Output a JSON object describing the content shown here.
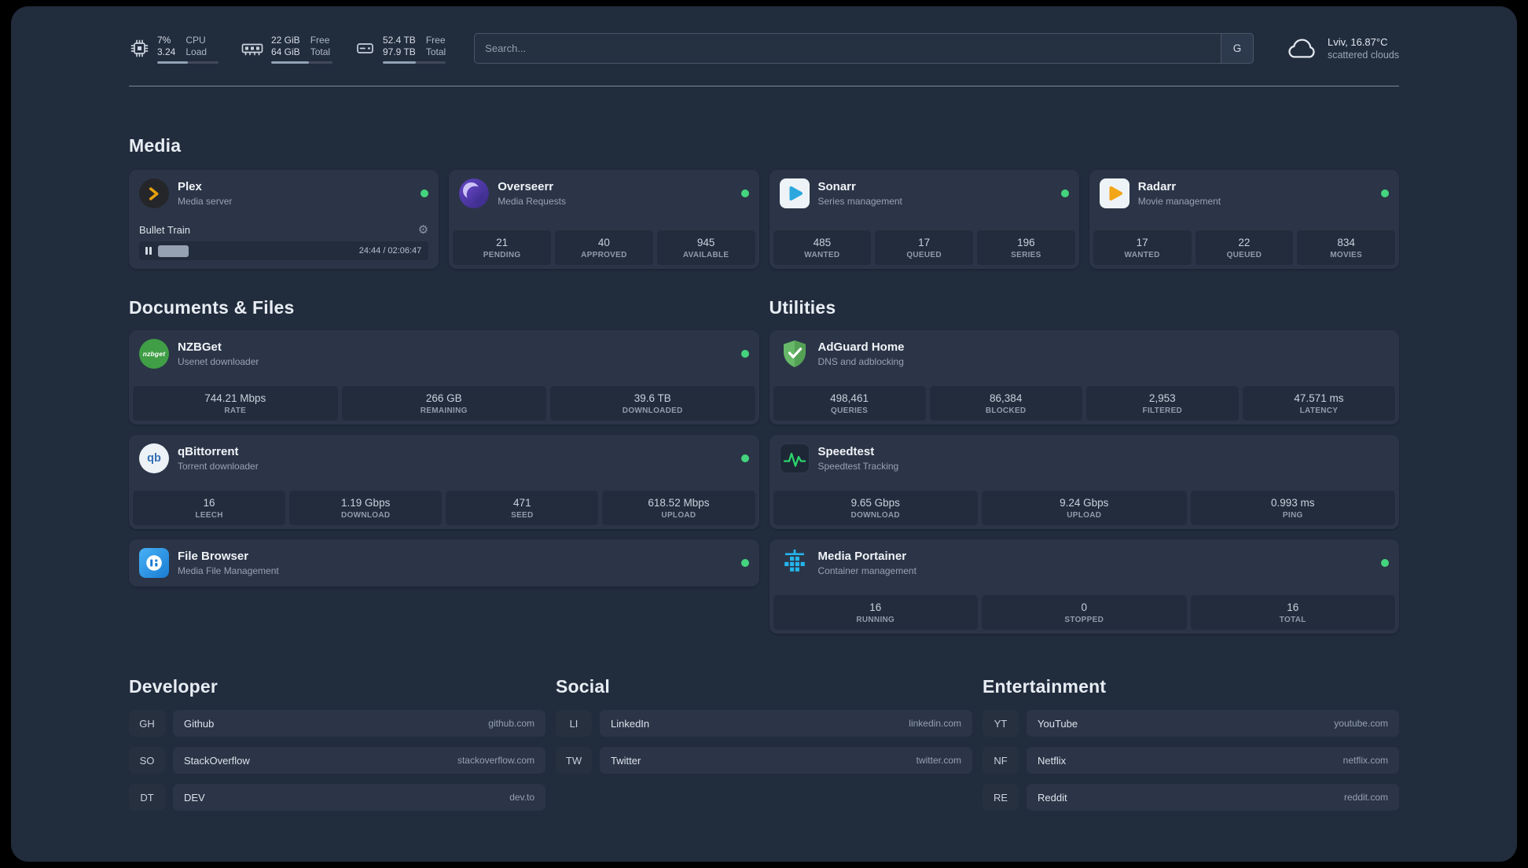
{
  "header": {
    "resources": [
      {
        "icon": "cpu-icon",
        "col1": [
          "7%",
          "3.24"
        ],
        "col2": [
          "CPU",
          "Load"
        ],
        "progress": 50
      },
      {
        "icon": "memory-icon",
        "col1": [
          "22 GiB",
          "64 GiB"
        ],
        "col2": [
          "Free",
          "Total"
        ],
        "progress": 62
      },
      {
        "icon": "disk-icon",
        "col1": [
          "52.4 TB",
          "97.9 TB"
        ],
        "col2": [
          "Free",
          "Total"
        ],
        "progress": 53
      }
    ],
    "search": {
      "placeholder": "Search...",
      "provider_button": "G"
    },
    "weather": {
      "location": "Lviv, 16.87°C",
      "description": "scattered clouds"
    }
  },
  "media": {
    "title": "Media",
    "plex": {
      "name": "Plex",
      "description": "Media server",
      "now_playing": "Bullet Train",
      "time": "24:44 / 02:06:47",
      "progress": 16
    },
    "overseerr": {
      "name": "Overseerr",
      "description": "Media Requests",
      "stats": [
        {
          "value": "21",
          "label": "PENDING"
        },
        {
          "value": "40",
          "label": "APPROVED"
        },
        {
          "value": "945",
          "label": "AVAILABLE"
        }
      ]
    },
    "sonarr": {
      "name": "Sonarr",
      "description": "Series management",
      "stats": [
        {
          "value": "485",
          "label": "WANTED"
        },
        {
          "value": "17",
          "label": "QUEUED"
        },
        {
          "value": "196",
          "label": "SERIES"
        }
      ]
    },
    "radarr": {
      "name": "Radarr",
      "description": "Movie management",
      "stats": [
        {
          "value": "17",
          "label": "WANTED"
        },
        {
          "value": "22",
          "label": "QUEUED"
        },
        {
          "value": "834",
          "label": "MOVIES"
        }
      ]
    }
  },
  "documents": {
    "title": "Documents & Files",
    "nzbget": {
      "name": "NZBGet",
      "description": "Usenet downloader",
      "stats": [
        {
          "value": "744.21 Mbps",
          "label": "RATE"
        },
        {
          "value": "266 GB",
          "label": "REMAINING"
        },
        {
          "value": "39.6 TB",
          "label": "DOWNLOADED"
        }
      ]
    },
    "qbittorrent": {
      "name": "qBittorrent",
      "description": "Torrent downloader",
      "stats": [
        {
          "value": "16",
          "label": "LEECH"
        },
        {
          "value": "1.19 Gbps",
          "label": "DOWNLOAD"
        },
        {
          "value": "471",
          "label": "SEED"
        },
        {
          "value": "618.52 Mbps",
          "label": "UPLOAD"
        }
      ]
    },
    "filebrowser": {
      "name": "File Browser",
      "description": "Media File Management"
    }
  },
  "utilities": {
    "title": "Utilities",
    "adguard": {
      "name": "AdGuard Home",
      "description": "DNS and adblocking",
      "stats": [
        {
          "value": "498,461",
          "label": "QUERIES"
        },
        {
          "value": "86,384",
          "label": "BLOCKED"
        },
        {
          "value": "2,953",
          "label": "FILTERED"
        },
        {
          "value": "47.571 ms",
          "label": "LATENCY"
        }
      ]
    },
    "speedtest": {
      "name": "Speedtest",
      "description": "Speedtest Tracking",
      "stats": [
        {
          "value": "9.65 Gbps",
          "label": "DOWNLOAD"
        },
        {
          "value": "9.24 Gbps",
          "label": "UPLOAD"
        },
        {
          "value": "0.993 ms",
          "label": "PING"
        }
      ]
    },
    "portainer": {
      "name": "Media Portainer",
      "description": "Container management",
      "stats": [
        {
          "value": "16",
          "label": "RUNNING"
        },
        {
          "value": "0",
          "label": "STOPPED"
        },
        {
          "value": "16",
          "label": "TOTAL"
        }
      ]
    }
  },
  "bookmarks": [
    {
      "title": "Developer",
      "items": [
        {
          "abbr": "GH",
          "name": "Github",
          "href": "github.com"
        },
        {
          "abbr": "SO",
          "name": "StackOverflow",
          "href": "stackoverflow.com"
        },
        {
          "abbr": "DT",
          "name": "DEV",
          "href": "dev.to"
        }
      ]
    },
    {
      "title": "Social",
      "items": [
        {
          "abbr": "LI",
          "name": "LinkedIn",
          "href": "linkedin.com"
        },
        {
          "abbr": "TW",
          "name": "Twitter",
          "href": "twitter.com"
        }
      ]
    },
    {
      "title": "Entertainment",
      "items": [
        {
          "abbr": "YT",
          "name": "YouTube",
          "href": "youtube.com"
        },
        {
          "abbr": "NF",
          "name": "Netflix",
          "href": "netflix.com"
        },
        {
          "abbr": "RE",
          "name": "Reddit",
          "href": "reddit.com"
        }
      ]
    }
  ]
}
